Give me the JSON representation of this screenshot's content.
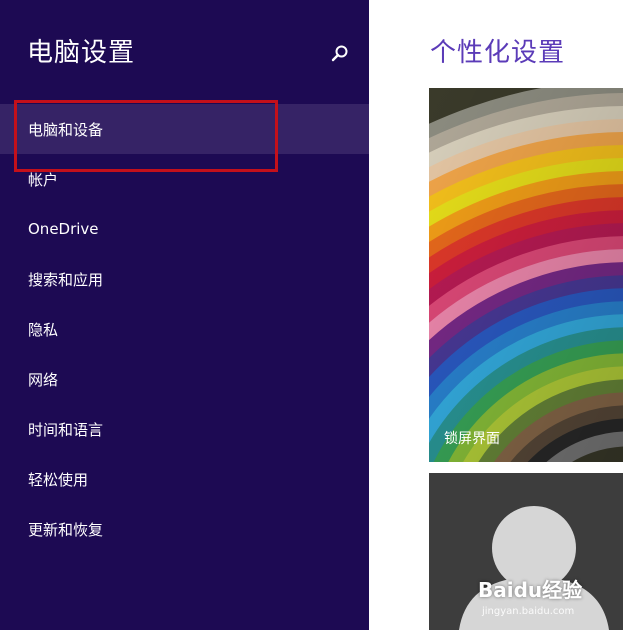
{
  "sidebar": {
    "title": "电脑设置",
    "search_icon": "search-icon",
    "items": [
      {
        "label": "电脑和设备",
        "selected": true
      },
      {
        "label": "帐户"
      },
      {
        "label": "OneDrive"
      },
      {
        "label": "搜索和应用"
      },
      {
        "label": "隐私"
      },
      {
        "label": "网络"
      },
      {
        "label": "时间和语言"
      },
      {
        "label": "轻松使用"
      },
      {
        "label": "更新和恢复"
      }
    ]
  },
  "main": {
    "title": "个性化设置",
    "tiles": [
      {
        "label": "锁屏界面"
      },
      {
        "label": ""
      }
    ]
  },
  "watermark": {
    "text": "Baidu经验",
    "url": "jingyan.baidu.com"
  },
  "colors": {
    "sidebar_bg": "#1d0a53",
    "selected_bg": "#362366",
    "accent": "#5b3bb8",
    "annotation": "#c4101b"
  }
}
